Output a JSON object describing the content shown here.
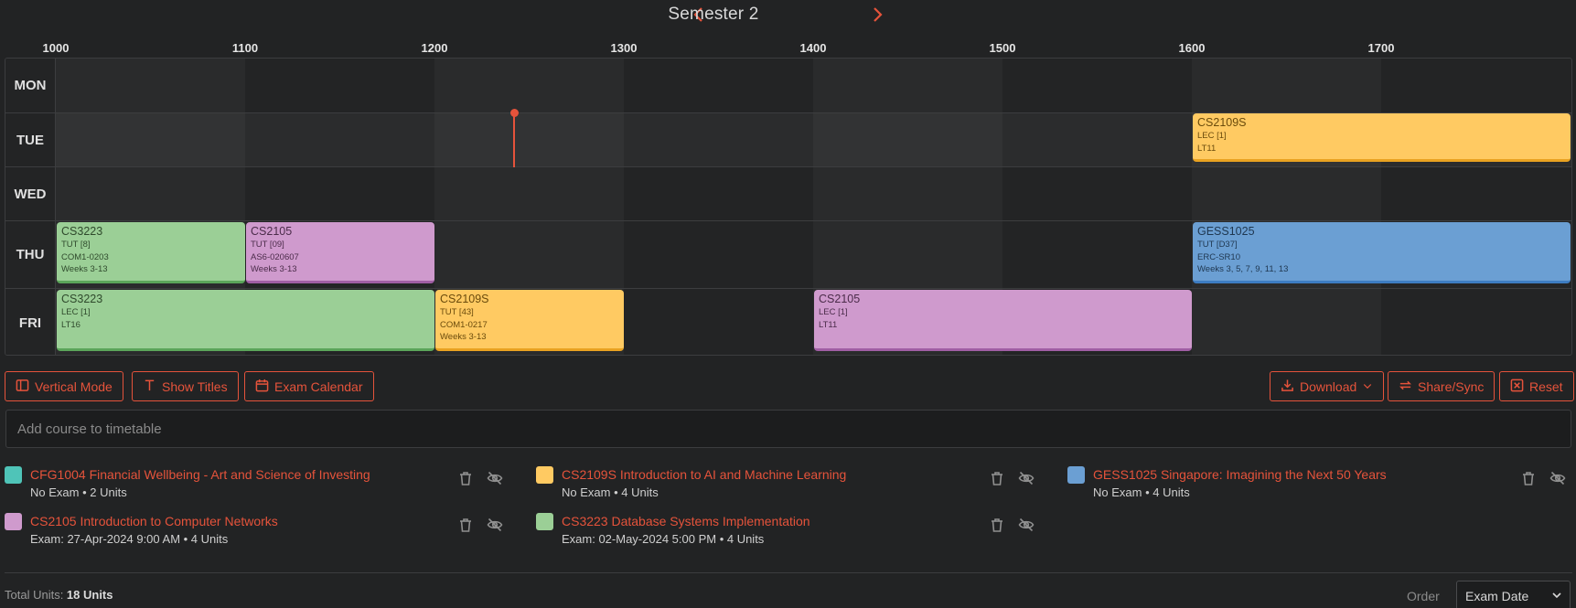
{
  "semester": {
    "title": "Semester 2"
  },
  "hours": [
    "1000",
    "1100",
    "1200",
    "1300",
    "1400",
    "1500",
    "1600",
    "1700"
  ],
  "days": [
    "MON",
    "TUE",
    "WED",
    "THU",
    "FRI"
  ],
  "lessons": [
    {
      "day": "TUE",
      "code": "CS2109S",
      "type": "LEC [1]",
      "venue": "LT11",
      "weeks": "",
      "color": "yellow",
      "start": "1600",
      "end": "1800"
    },
    {
      "day": "THU",
      "code": "CS3223",
      "type": "TUT [8]",
      "venue": "COM1-0203",
      "weeks": "Weeks 3-13",
      "color": "green",
      "start": "1000",
      "end": "1100"
    },
    {
      "day": "THU",
      "code": "CS2105",
      "type": "TUT [09]",
      "venue": "AS6-020607",
      "weeks": "Weeks 3-13",
      "color": "purple",
      "start": "1100",
      "end": "1200"
    },
    {
      "day": "THU",
      "code": "GESS1025",
      "type": "TUT [D37]",
      "venue": "ERC-SR10",
      "weeks": "Weeks 3, 5, 7, 9, 11, 13",
      "color": "blue",
      "start": "1600",
      "end": "1800"
    },
    {
      "day": "FRI",
      "code": "CS3223",
      "type": "LEC [1]",
      "venue": "LT16",
      "weeks": "",
      "color": "green",
      "start": "1000",
      "end": "1200"
    },
    {
      "day": "FRI",
      "code": "CS2109S",
      "type": "TUT [43]",
      "venue": "COM1-0217",
      "weeks": "Weeks 3-13",
      "color": "yellow",
      "start": "1200",
      "end": "1300"
    },
    {
      "day": "FRI",
      "code": "CS2105",
      "type": "LEC [1]",
      "venue": "LT11",
      "weeks": "",
      "color": "purple",
      "start": "1400",
      "end": "1600"
    }
  ],
  "toolbar": {
    "vertical_mode": "Vertical Mode",
    "show_titles": "Show Titles",
    "exam_calendar": "Exam Calendar",
    "download": "Download",
    "share_sync": "Share/Sync",
    "reset": "Reset"
  },
  "add_course": {
    "placeholder": "Add course to timetable"
  },
  "modules": [
    {
      "title": "CFG1004 Financial Wellbeing - Art and Science of Investing",
      "sub": "No Exam • 2 Units",
      "color": "#4fc4b8"
    },
    {
      "title": "CS2109S Introduction to AI and Machine Learning",
      "sub": "No Exam • 4 Units",
      "color": "#ffca62"
    },
    {
      "title": "GESS1025 Singapore: Imagining the Next 50 Years",
      "sub": "No Exam • 4 Units",
      "color": "#6b9fd3"
    },
    {
      "title": "CS2105 Introduction to Computer Networks",
      "sub": "Exam: 27-Apr-2024 9:00 AM • 4 Units",
      "color": "#cf9acd"
    },
    {
      "title": "CS3223 Database Systems Implementation",
      "sub": "Exam: 02-May-2024 5:00 PM • 4 Units",
      "color": "#9bcf96"
    }
  ],
  "footer": {
    "total_label": "Total Units: ",
    "total_value": "18 Units",
    "order_label": "Order",
    "order_value": "Exam Date"
  },
  "colors": {
    "accent": "#e5533b",
    "background": "#222324"
  }
}
